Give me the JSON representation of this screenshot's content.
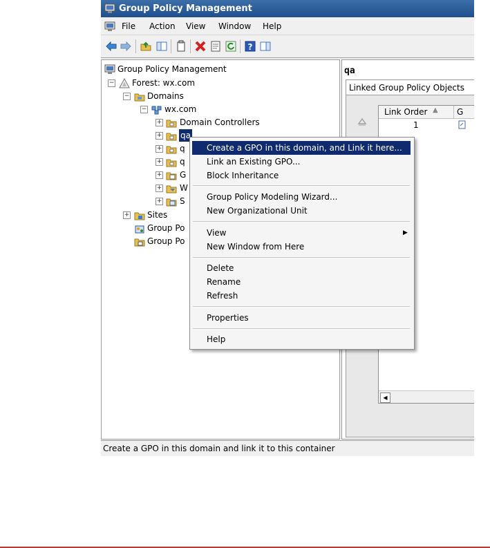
{
  "window": {
    "title": "Group Policy Management"
  },
  "menubar": {
    "items": [
      "File",
      "Action",
      "View",
      "Window",
      "Help"
    ]
  },
  "tree": {
    "root": "Group Policy Management",
    "forest": "Forest: wx.com",
    "domains": "Domains",
    "domain": "wx.com",
    "domain_controllers": "Domain Controllers",
    "qa": "qa",
    "q2": "q",
    "q3": "q",
    "g": "G",
    "w": "W",
    "s": "S",
    "sites": "Sites",
    "gp_modeling": "Group Po",
    "gp_results": "Group Po"
  },
  "details": {
    "header": "qa",
    "tab": "Linked Group Policy Objects",
    "columns": [
      "Link Order",
      "G"
    ],
    "rows": [
      {
        "link_order": "1"
      }
    ]
  },
  "context_menu": {
    "items": [
      "Create a GPO in this domain, and Link it here...",
      "Link an Existing GPO...",
      "Block Inheritance",
      "Group Policy Modeling Wizard...",
      "New Organizational Unit",
      "View",
      "New Window from Here",
      "Delete",
      "Rename",
      "Refresh",
      "Properties",
      "Help"
    ]
  },
  "status": {
    "text": "Create a GPO in this domain and link it to this container"
  },
  "colors": {
    "title_bar": "#1f4f8c",
    "menu_highlight": "#0f2a6e",
    "bottom_rule": "#c0392b"
  }
}
